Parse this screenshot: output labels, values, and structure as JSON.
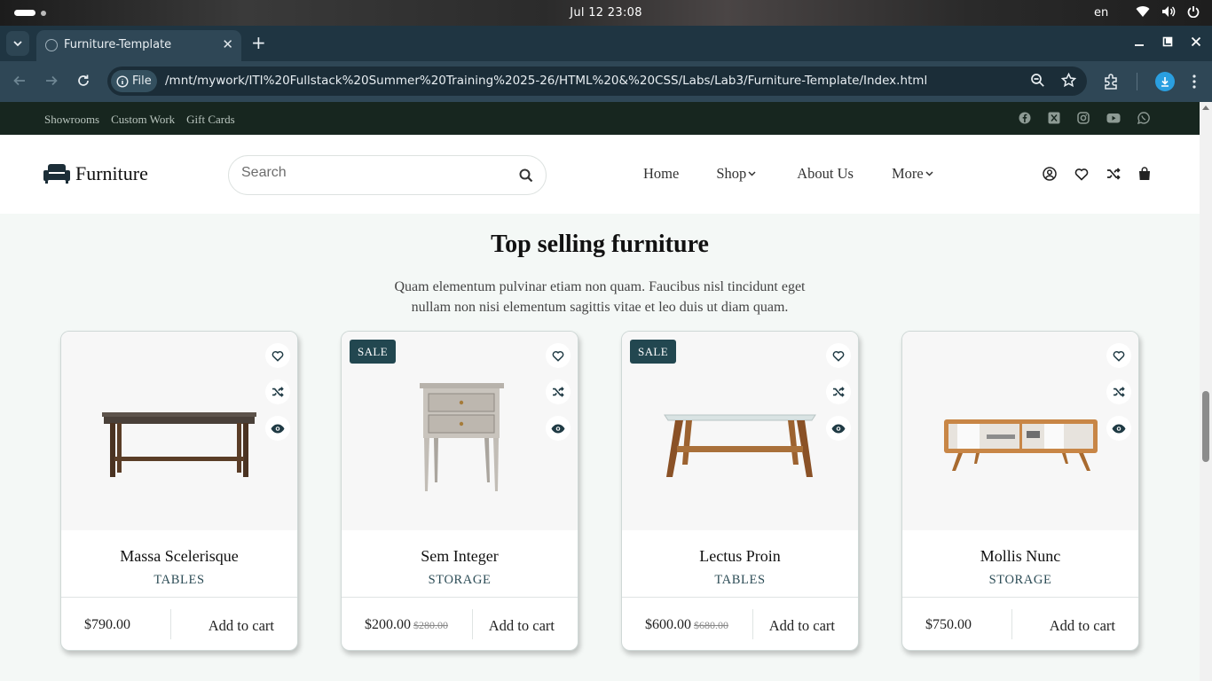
{
  "os": {
    "clock": "Jul 12  23:08",
    "lang": "en"
  },
  "browser": {
    "tab_title": "Furniture-Template",
    "tab_close": "✕",
    "new_tab": "+",
    "chip_label": "File",
    "url": "/mnt/mywork/ITI%20Fullstack%20Summer%20Training%2025-26/HTML%20&%20CSS/Labs/Lab3/Furniture-Template/Index.html"
  },
  "topbar": {
    "links": [
      "Showrooms",
      "Custom Work",
      "Gift Cards"
    ],
    "social": [
      "facebook-icon",
      "x-twitter-icon",
      "instagram-icon",
      "youtube-icon",
      "whatsapp-icon"
    ]
  },
  "header": {
    "logo_text": "Furniture",
    "search_placeholder": "Search",
    "nav": [
      {
        "label": "Home",
        "dropdown": false
      },
      {
        "label": "Shop",
        "dropdown": true
      },
      {
        "label": "About Us",
        "dropdown": false
      },
      {
        "label": "More",
        "dropdown": true
      }
    ],
    "icons": [
      "user-icon",
      "heart-icon",
      "shuffle-icon",
      "bag-icon"
    ]
  },
  "section": {
    "title": "Top selling furniture",
    "subtitle": "Quam elementum pulvinar etiam non quam. Faucibus nisl tincidunt eget nullam non nisi elementum sagittis vitae et leo duis ut diam quam."
  },
  "products": [
    {
      "name": "Massa Scelerisque",
      "category": "TABLES",
      "price": "$790.00",
      "old_price": "",
      "sale": false,
      "add_label": "Add to cart"
    },
    {
      "name": "Sem Integer",
      "category": "STORAGE",
      "price": "$200.00",
      "old_price": "$280.00",
      "sale": true,
      "sale_label": "SALE",
      "add_label": "Add to cart"
    },
    {
      "name": "Lectus Proin",
      "category": "TABLES",
      "price": "$600.00",
      "old_price": "$680.00",
      "sale": true,
      "sale_label": "SALE",
      "add_label": "Add to cart"
    },
    {
      "name": "Mollis Nunc",
      "category": "STORAGE",
      "price": "$750.00",
      "old_price": "",
      "sale": false,
      "add_label": "Add to cart"
    }
  ],
  "colors": {
    "accent": "#224750",
    "topbar": "#17261f",
    "page_bg": "#f4f8f6"
  }
}
